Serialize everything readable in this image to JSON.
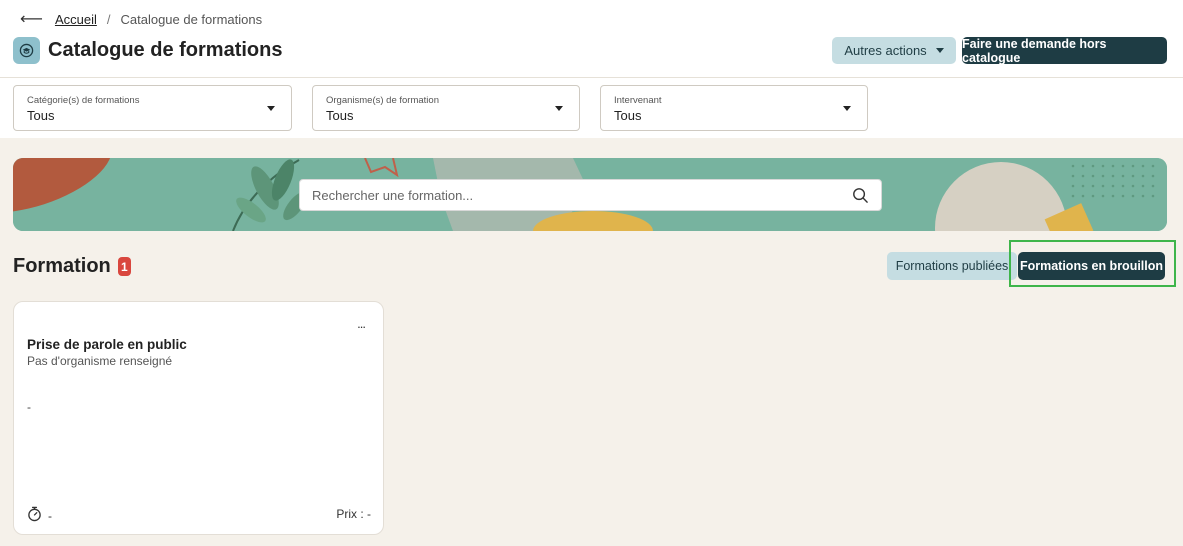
{
  "breadcrumb": {
    "back_icon": "arrow-left-icon",
    "home": "Accueil",
    "separator": "/",
    "current": "Catalogue de formations"
  },
  "header": {
    "title": "Catalogue de formations",
    "title_icon": "graduation-cap-icon",
    "other_actions_label": "Autres actions",
    "request_label": "Faire une demande hors catalogue"
  },
  "filters": [
    {
      "label": "Catégorie(s) de formations",
      "value": "Tous"
    },
    {
      "label": "Organisme(s) de formation",
      "value": "Tous"
    },
    {
      "label": "Intervenant",
      "value": "Tous"
    }
  ],
  "search": {
    "placeholder": "Rechercher une formation..."
  },
  "section": {
    "title": "Formation",
    "count": "1"
  },
  "toggle": {
    "published_label": "Formations publiées",
    "draft_label": "Formations en brouillon",
    "selected": "draft"
  },
  "cards": [
    {
      "menu": "...",
      "title": "Prise de parole en public",
      "organization": "Pas d'organisme renseigné",
      "description": "-",
      "duration_icon": "stopwatch-icon",
      "duration": "-",
      "price": "Prix : -"
    }
  ],
  "colors": {
    "primary": "#1e3c44",
    "secondary": "#c5dde2",
    "badge": "#d9473e",
    "highlight": "#3eb54a",
    "banner": "#77b39f"
  }
}
